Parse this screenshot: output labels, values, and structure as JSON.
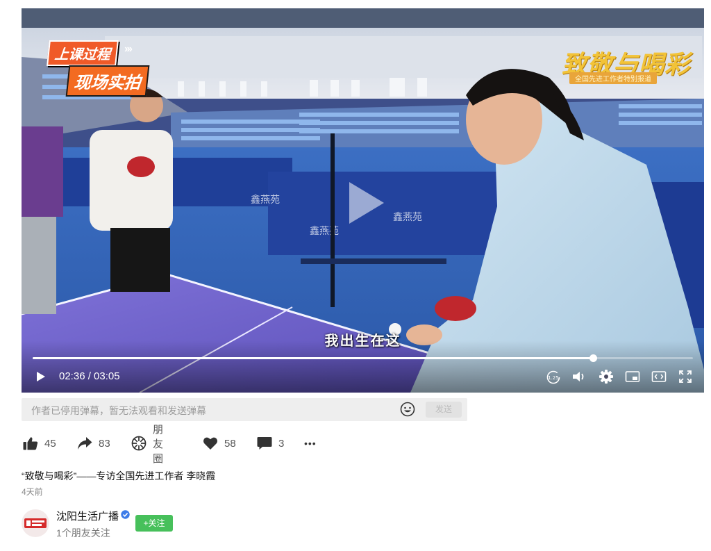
{
  "video": {
    "overlay_tag_1": "上课过程",
    "overlay_tag_2": "现场实拍",
    "overlay_arrows": "›››",
    "brand_title": "致敬与喝彩",
    "brand_sub": "全国先进工作者特别报道",
    "subtitle": "我出生在这",
    "time": "02:36 / 03:05",
    "progress_fraction": 0.8486,
    "speed_label": "1.25",
    "colors": {
      "accent": "#f05a28",
      "brand": "#f2c338"
    }
  },
  "danmu": {
    "notice": "作者已停用弹幕，暂无法观看和发送弹幕",
    "send_label": "发送"
  },
  "actions": {
    "like_count": "45",
    "share_count": "83",
    "moments_label": "朋友圈",
    "favorite_count": "58",
    "comment_count": "3",
    "more_label": "•••"
  },
  "post": {
    "title": "“致敬与喝彩”——专访全国先进工作者 李晓霞",
    "date": "4天前"
  },
  "author": {
    "name": "沈阳生活广播",
    "follow_label": "+关注",
    "friends_text": "1个朋友关注",
    "follow_color": "#47c05b"
  },
  "icons": [
    "play-icon",
    "speed-icon",
    "volume-icon",
    "settings-icon",
    "pip-icon",
    "widescreen-icon",
    "fullscreen-icon",
    "emoji-icon",
    "thumbs-up-icon",
    "share-arrow-icon",
    "moments-icon",
    "heart-icon",
    "comment-icon",
    "verified-icon"
  ]
}
